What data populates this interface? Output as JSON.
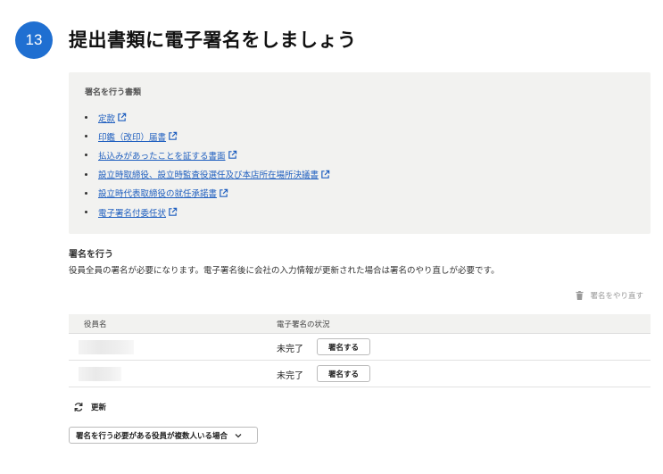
{
  "step": {
    "number": "13"
  },
  "page_title": "提出書類に電子署名をしましょう",
  "documents": {
    "heading": "署名を行う書類",
    "items": [
      {
        "label": "定款"
      },
      {
        "label": "印鑑（改印）届書"
      },
      {
        "label": "払込みがあったことを証する書面"
      },
      {
        "label": "設立時取締役、設立時監査役選任及び本店所在場所決議書"
      },
      {
        "label": "設立時代表取締役の就任承諾書"
      },
      {
        "label": "電子署名付委任状"
      }
    ]
  },
  "sign_section": {
    "heading": "署名を行う",
    "description": "役員全員の署名が必要になります。電子署名後に会社の入力情報が更新された場合は署名のやり直しが必要です。",
    "redo_label": "署名をやり直す"
  },
  "table": {
    "headers": {
      "name": "役員名",
      "status": "電子署名の状況"
    },
    "rows": [
      {
        "name": "",
        "status": "未完了",
        "action": "署名する"
      },
      {
        "name": "",
        "status": "未完了",
        "action": "署名する"
      }
    ]
  },
  "refresh_label": "更新",
  "multi_signers_select": {
    "value": "署名を行う必要がある役員が複数人いる場合"
  },
  "colors": {
    "accent": "#1f6fd1",
    "link": "#1f5fbf",
    "panel_bg": "#f2f2f0"
  },
  "icons": [
    "external-link-icon",
    "trash-icon",
    "refresh-icon",
    "chevron-down-icon"
  ]
}
